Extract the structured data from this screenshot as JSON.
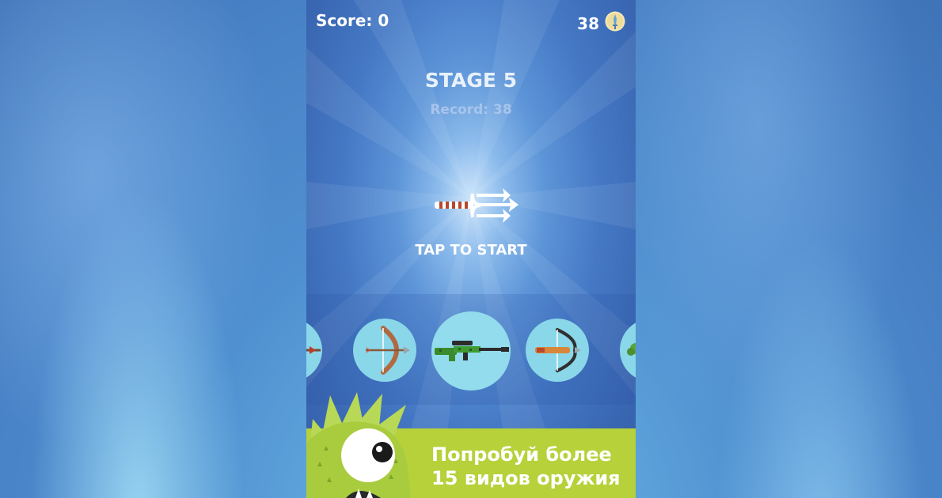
{
  "hud": {
    "score_label": "Score: 0",
    "coins": "38",
    "coin_icon": "dagger-coin-icon"
  },
  "stage": {
    "title": "STAGE 5",
    "record": "Record: 38"
  },
  "current_weapon": "trident-icon",
  "start_prompt": "TAP TO START",
  "weapon_carousel": [
    {
      "icon": "partial-weapon-icon",
      "selected": false
    },
    {
      "icon": "bow-icon",
      "selected": false
    },
    {
      "icon": "sniper-rifle-icon",
      "selected": true
    },
    {
      "icon": "crossbow-icon",
      "selected": false
    },
    {
      "icon": "partial-weapon-icon",
      "selected": false
    }
  ],
  "promo": {
    "line1": "Попробуй более",
    "line2": "15 видов оружия",
    "mascot": "green-monster-icon"
  },
  "colors": {
    "banner": "#b6d13a",
    "weapon_circle": "#8ad7e9",
    "monster": "#a9cc3e"
  }
}
